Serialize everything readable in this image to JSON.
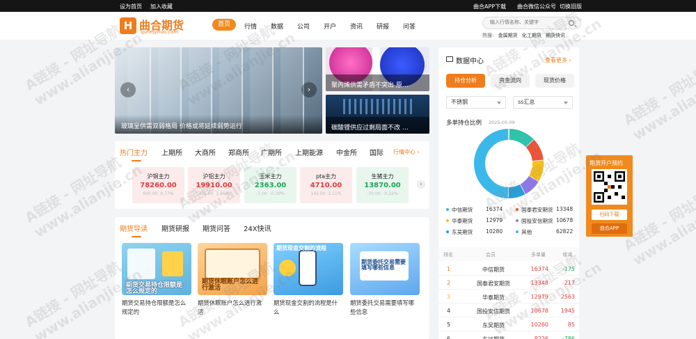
{
  "topbar": {
    "set_home": "设为首页",
    "bookmark": "加入收藏",
    "app_download": "曲合APP下载",
    "wechat": "曲合微信公众号",
    "old_version": "切换旧版"
  },
  "header": {
    "logo_name": "曲合期货",
    "logo_domain": "quheqihuo.com",
    "nav": [
      "首页",
      "行情",
      "数据",
      "公司",
      "开户",
      "资讯",
      "研报",
      "问答"
    ],
    "search_placeholder": "输入行情名称、关键字",
    "hot_label": "热搜:",
    "hot_links": [
      "金属期货",
      "化工期货",
      "期货快讯"
    ]
  },
  "slider": {
    "caption": "玻璃呈供需双弱格局 价格或将延续弱势运行",
    "side_top": "聚丙烯供需矛盾不突出 原…",
    "side_bottom": "碳酸锂供应过剩局面不改 …"
  },
  "market": {
    "tabs": [
      "热门主力",
      "上期所",
      "大商所",
      "郑商所",
      "广期所",
      "上期能源",
      "中金所",
      "国际"
    ],
    "more": "行情中心",
    "quotes": [
      {
        "name": "沪铜主力",
        "price": "78260.00",
        "change": "600.00",
        "pct": "0.77%",
        "trend": "up"
      },
      {
        "name": "沪铝主力",
        "price": "19910.00",
        "change": "325.00",
        "pct": "1.66%",
        "trend": "up"
      },
      {
        "name": "玉米主力",
        "price": "2363.00",
        "change": "-7.00",
        "pct": "-0.30%",
        "trend": "down"
      },
      {
        "name": "pta主力",
        "price": "4710.00",
        "change": "142.00",
        "pct": "3.11%",
        "trend": "up"
      },
      {
        "name": "生猪主力",
        "price": "13870.00",
        "change": "-30.00",
        "pct": "-0.22%",
        "trend": "down"
      }
    ]
  },
  "guide": {
    "tabs": [
      "期货导读",
      "期货研报",
      "期货问答",
      "24X快讯"
    ],
    "articles": [
      {
        "thumb_title": "期货交易持仓限额是怎么规定的",
        "desc": "期货交易持仓限额是怎么规定的"
      },
      {
        "thumb_title": "期货休眠账户怎么进行激活",
        "desc": "期货休眠账户怎么进行激活"
      },
      {
        "thumb_title": "期货现金交割的流程",
        "desc": "期货现金交割的流程是什么"
      },
      {
        "thumb_title": "期货委托交易需要填写哪些信息",
        "desc": "期货委托交易需要填写哪些信息"
      }
    ]
  },
  "data_center": {
    "title": "数据中心",
    "more": "查看更多",
    "pills": [
      "持仓分析",
      "资金流向",
      "现货价格"
    ],
    "select_left": "不锈钢",
    "select_right": "ss汇总",
    "chart_title": "多单持仓比例",
    "chart_date": "2025-05-09",
    "chart_data": {
      "type": "pie",
      "title": "多单持仓比例",
      "labels": [
        "中信期货",
        "国泰君安期货",
        "华泰期货",
        "国投安信期货",
        "东吴期货",
        "其他"
      ],
      "values": [
        16374,
        13348,
        12979,
        10678,
        10280,
        62822
      ],
      "colors": [
        "#2fc3ac",
        "#e8553a",
        "#f7c11e",
        "#8e78e8",
        "#26a0d8",
        "#3bb8ea"
      ]
    },
    "table_header": [
      "排名",
      "会员",
      "多单量",
      "增减"
    ],
    "table_rows": [
      {
        "rank": "1",
        "member": "中信期货",
        "volume": "16374",
        "change": "-175"
      },
      {
        "rank": "2",
        "member": "国泰君安期货",
        "volume": "13348",
        "change": "217"
      },
      {
        "rank": "3",
        "member": "华泰期货",
        "volume": "12979",
        "change": "2563"
      },
      {
        "rank": "4",
        "member": "国投安信期货",
        "volume": "10678",
        "change": "1945"
      },
      {
        "rank": "5",
        "member": "东吴期货",
        "volume": "10260",
        "change": "85"
      },
      {
        "rank": "6",
        "member": "东证期货",
        "volume": "8226",
        "change": "-786"
      }
    ]
  },
  "promo": {
    "title": "期货开户预约",
    "scan": "扫码下载",
    "app": "曲合APP"
  },
  "watermark": {
    "line1": "A链接 - 网址导航",
    "line2": "www.alianjie.cn"
  },
  "colors": {
    "brand": "#f07c1c",
    "up": "#e4393c",
    "down": "#1aa35a"
  }
}
